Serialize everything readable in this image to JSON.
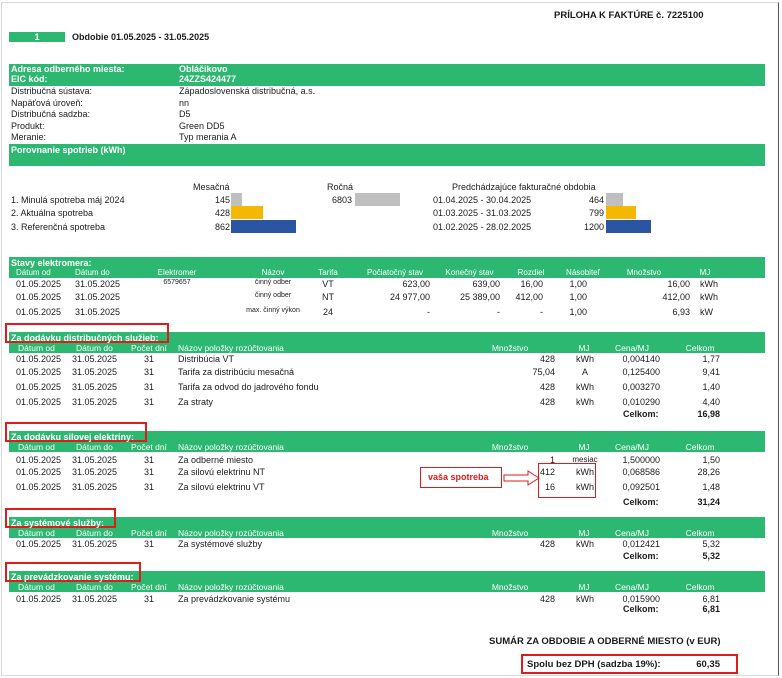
{
  "header": {
    "title": "PRÍLOHA K FAKTÚRE č. 7225100",
    "index": "1",
    "period": "Obdobie 01.05.2025 - 31.05.2025"
  },
  "info": {
    "rows": [
      {
        "label": "Adresa odberného miesta:",
        "value": "Obláčikovo"
      },
      {
        "label": "EIC kód:",
        "value": "24ZZS424477"
      },
      {
        "label": "Distribučná sústava:",
        "value": "Západoslovenská distribučná, a.s."
      },
      {
        "label": "Napäťová úroveň:",
        "value": "nn"
      },
      {
        "label": "Distribučná sadzba:",
        "value": "D5"
      },
      {
        "label": "Produkt:",
        "value": "Green DD5"
      },
      {
        "label": "Meranie:",
        "value": "Typ merania A"
      }
    ],
    "compare_title": "Porovnanie spotrieb (kWh)"
  },
  "compare": {
    "col_monthly": "Mesačná",
    "col_yearly": "Ročná",
    "col_prev": "Predchádzajúce fakturačné obdobia",
    "rows": [
      {
        "label": "1. Minulá spotreba máj 2024",
        "monthly": "145",
        "yearly": "6803",
        "prev_period": "01.04.2025 - 30.04.2025",
        "prev_value": "464"
      },
      {
        "label": "2. Aktuálna spotreba",
        "monthly": "428",
        "yearly": "",
        "prev_period": "01.03.2025 - 31.03.2025",
        "prev_value": "799"
      },
      {
        "label": "3. Referenčná spotreba",
        "monthly": "862",
        "yearly": "",
        "prev_period": "01.02.2025 - 28.02.2025",
        "prev_value": "1200"
      }
    ],
    "monthly_levels": [
      145,
      428,
      862
    ],
    "yearly_level": [
      6803
    ],
    "prev_levels": [
      464,
      799,
      1200
    ],
    "colors": {
      "gray": "#bfbfbf",
      "yellow": "#f5b800",
      "blue": "#2a55a3",
      "green": "#2db871",
      "red": "#e01b1b"
    }
  },
  "meters": {
    "title": "Stavy elektromera:",
    "headers": [
      "Dátum od",
      "Dátum do",
      "Elektromer",
      "Názov",
      "Tarifa",
      "Počiatočný stav",
      "Konečný stav",
      "Rozdiel",
      "Násobiteľ",
      "Množstvo",
      "MJ"
    ],
    "rows": [
      [
        "01.05.2025",
        "31.05.2025",
        "6579657",
        "činný odber",
        "VT",
        "623,00",
        "639,00",
        "16,00",
        "1,00",
        "16,00",
        "kWh"
      ],
      [
        "01.05.2025",
        "31.05.2025",
        "",
        "činný odber",
        "NT",
        "24 977,00",
        "25 389,00",
        "412,00",
        "1,00",
        "412,00",
        "kWh"
      ],
      [
        "01.05.2025",
        "31.05.2025",
        "",
        "max. činný výkon",
        "24",
        "-",
        "-",
        "-",
        "1,00",
        "6,93",
        "kW"
      ]
    ]
  },
  "item_headers": [
    "Dátum od",
    "Dátum do",
    "Počet dní",
    "Názov položky rozúčtovania",
    "Množstvo",
    "MJ",
    "Cena/MJ",
    "Celkom"
  ],
  "sections": [
    {
      "title": "Za dodávku distribučných služieb:",
      "rows": [
        [
          "01.05.2025",
          "31.05.2025",
          "31",
          "Distribúcia VT",
          "428",
          "kWh",
          "0,004140",
          "1,77"
        ],
        [
          "01.05.2025",
          "31.05.2025",
          "31",
          "Tarifa za distribúciu mesačná",
          "75,04",
          "A",
          "0,125400",
          "9,41"
        ],
        [
          "01.05.2025",
          "31.05.2025",
          "31",
          "Tarifa za odvod do jadrového fondu",
          "428",
          "kWh",
          "0,003270",
          "1,40"
        ],
        [
          "01.05.2025",
          "31.05.2025",
          "31",
          "Za straty",
          "428",
          "kWh",
          "0,010290",
          "4,40"
        ]
      ],
      "total_label": "Celkom:",
      "total": "16,98"
    },
    {
      "title": "Za dodávku silovej elektriny:",
      "rows": [
        [
          "01.05.2025",
          "31.05.2025",
          "31",
          "Za odberné miesto",
          "1",
          "mesiac",
          "1,500000",
          "1,50"
        ],
        [
          "01.05.2025",
          "31.05.2025",
          "31",
          "Za silovú elektrinu NT",
          "412",
          "kWh",
          "0,068586",
          "28,26"
        ],
        [
          "01.05.2025",
          "31.05.2025",
          "31",
          "Za silovú elektrinu VT",
          "16",
          "kWh",
          "0,092501",
          "1,48"
        ]
      ],
      "total_label": "Celkom:",
      "total": "31,24",
      "note": "vaša spotreba"
    },
    {
      "title": "Za systémové služby:",
      "rows": [
        [
          "01.05.2025",
          "31.05.2025",
          "31",
          "Za systémové služby",
          "428",
          "kWh",
          "0,012421",
          "5,32"
        ]
      ],
      "total_label": "Celkom:",
      "total": "5,32"
    },
    {
      "title": "Za prevádzkovanie systému:",
      "rows": [
        [
          "01.05.2025",
          "31.05.2025",
          "31",
          "Za prevádzkovanie systému",
          "428",
          "kWh",
          "0,015900",
          "6,81"
        ]
      ],
      "total_label": "Celkom:",
      "total": "6,81"
    }
  ],
  "summary": {
    "title": "SUMÁR ZA OBDOBIE A ODBERNÉ MIESTO (v EUR)",
    "label": "Spolu bez DPH (sadzba 19%):",
    "value": "60,35"
  }
}
